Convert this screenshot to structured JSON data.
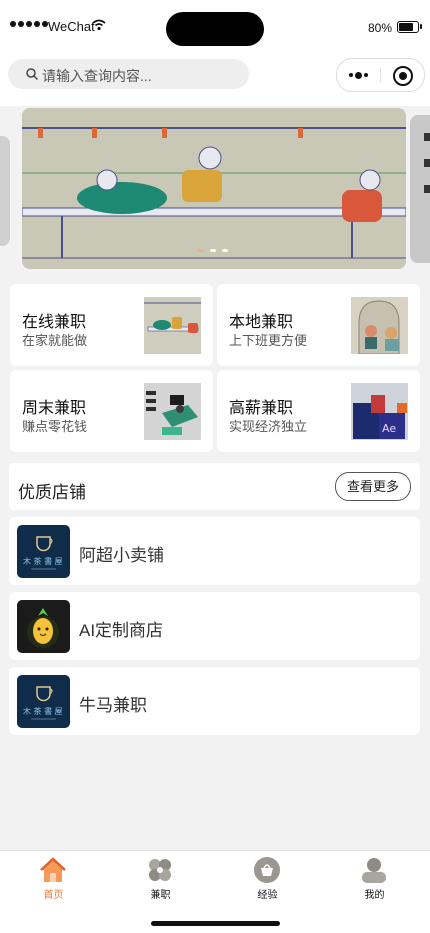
{
  "status_bar": {
    "carrier": "WeChat",
    "battery": "80%"
  },
  "header": {
    "search_placeholder": "请输入查询内容..."
  },
  "banner": {
    "slide_count": 3,
    "active_index": 0
  },
  "categories": [
    {
      "title": "在线兼职",
      "subtitle": "在家就能做"
    },
    {
      "title": "本地兼职",
      "subtitle": "上下班更方便"
    },
    {
      "title": "周末兼职",
      "subtitle": "赚点零花钱"
    },
    {
      "title": "高薪兼职",
      "subtitle": "实现经济独立"
    }
  ],
  "shops_section": {
    "title": "优质店铺",
    "more_label": "查看更多",
    "shops": [
      {
        "name": "阿超小卖铺",
        "logo": "coffee-logo"
      },
      {
        "name": "AI定制商店",
        "logo": "pineapple-logo"
      },
      {
        "name": "牛马兼职",
        "logo": "coffee-logo"
      }
    ]
  },
  "tabbar": {
    "tabs": [
      {
        "label": "首页",
        "icon": "home-icon",
        "active": true
      },
      {
        "label": "兼职",
        "icon": "clover-icon",
        "active": false
      },
      {
        "label": "经验",
        "icon": "basket-icon",
        "active": false
      },
      {
        "label": "我的",
        "icon": "user-icon",
        "active": false
      }
    ],
    "active_color": "#f07a3a"
  }
}
